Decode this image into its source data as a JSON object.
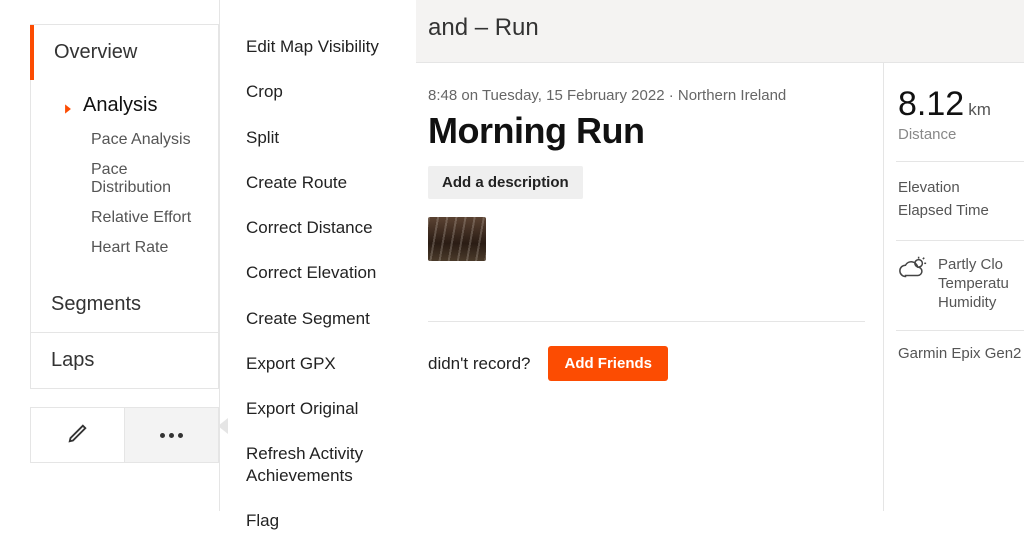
{
  "sidebar": {
    "tabs": {
      "overview": "Overview",
      "segments": "Segments",
      "laps": "Laps"
    },
    "analysis": {
      "heading": "Analysis",
      "items": [
        "Pace Analysis",
        "Pace Distribution",
        "Relative Effort",
        "Heart Rate"
      ]
    }
  },
  "dropdown": {
    "items": [
      "Edit Map Visibility",
      "Crop",
      "Split",
      "Create Route",
      "Correct Distance",
      "Correct Elevation",
      "Create Segment",
      "Export GPX",
      "Export Original",
      "Refresh Activity Achievements",
      "Flag"
    ]
  },
  "header": {
    "crumb_fragment": "and – Run"
  },
  "activity": {
    "meta_fragment": "8:48 on Tuesday, 15 February 2022 · Northern Ireland",
    "title_fragment": "Morning Run",
    "add_description": "Add a description",
    "record_prompt": "didn't record?",
    "add_friends": "Add Friends"
  },
  "stats": {
    "distance_value": "8.12",
    "distance_unit": "km",
    "distance_label": "Distance",
    "elevation_label": "Elevation",
    "elapsed_label": "Elapsed Time",
    "weather_condition_fragment": "Partly Clo",
    "weather_temp_fragment": "Temperatu",
    "weather_humidity_fragment": "Humidity",
    "device_fragment": "Garmin Epix Gen2"
  }
}
